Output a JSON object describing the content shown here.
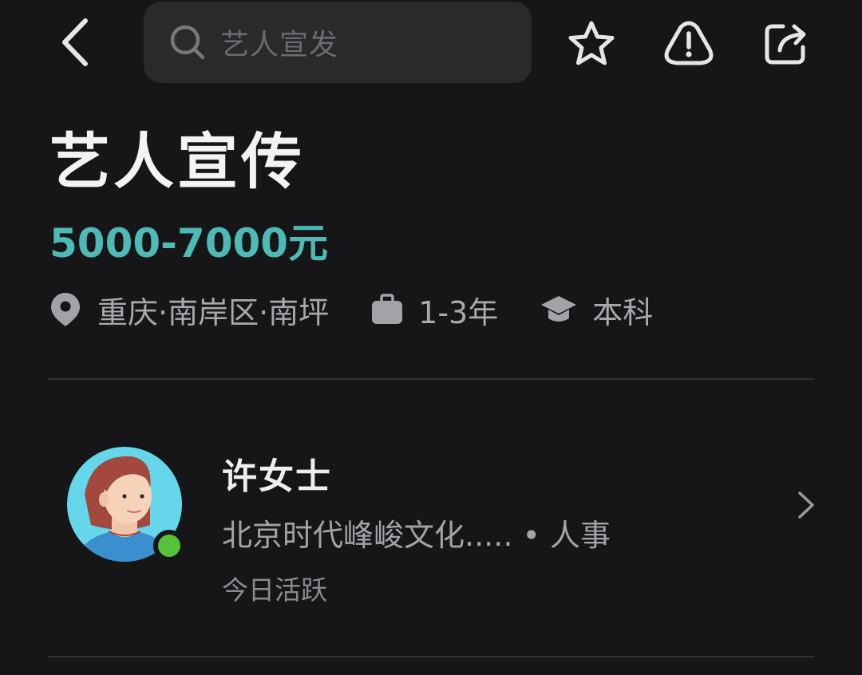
{
  "header": {
    "search_placeholder": "艺人宣发"
  },
  "job": {
    "title": "艺人宣传",
    "salary": "5000-7000元",
    "location": "重庆·南岸区·南坪",
    "experience": "1-3年",
    "education": "本科"
  },
  "recruiter": {
    "name": "许女士",
    "company_role": "北京时代峰峻文化..... • 人事",
    "status": "今日活跃"
  },
  "colors": {
    "background": "#161618",
    "accent_salary": "#4dbab5",
    "online": "#55c23a",
    "search_bg": "#2a2a2d"
  }
}
